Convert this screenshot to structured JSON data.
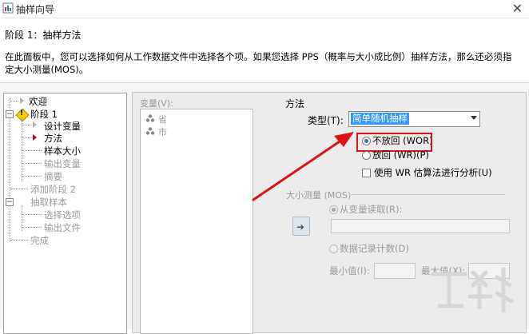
{
  "window": {
    "title": "抽样向导",
    "close_glyph": "✕"
  },
  "stage": {
    "title": "阶段 1：抽样方法",
    "description": "在此面板中，您可以选择如何从工作数据文件中选择各个项。如果您选择 PPS（概率与大小成比例）抽样方法，那么还必须指定大小测量(MOS)。"
  },
  "tree": {
    "welcome": "欢迎",
    "stage1": "阶段 1",
    "design_vars": "设计变量",
    "method": "方法",
    "sample_size": "样本大小",
    "output_vars": "输出变量",
    "summary": "摘要",
    "add_stage2": "添加阶段 2",
    "draw_sample": "抽取样本",
    "select_options": "选择选项",
    "output_files": "输出文件",
    "finish": "完成"
  },
  "variables": {
    "label": "变量(V):",
    "items": [
      "省",
      "市"
    ]
  },
  "method": {
    "section_label": "方法",
    "type_label": "类型(T):",
    "type_value": "简单随机抽样",
    "without_replacement": "不放回 (WOR)",
    "with_replacement": "放回 (WR)(P)",
    "use_wr_estimation": "使用 WR 估算法进行分析(U)"
  },
  "size_measure": {
    "section_label": "大小测量 (MOS)",
    "read_from_variable": "从变量读取(R):",
    "record_count": "数据记录计数(D)",
    "min_label": "最小值(I):",
    "max_label": "最大值(X):"
  },
  "colors": {
    "annotation_red": "#d8151b",
    "selection_blue": "#3399ff",
    "stage_diamond": "#f7cf00"
  },
  "icons": {
    "nav_arrow_active": "red-triangle",
    "nav_arrow_inactive": "gray-triangle",
    "stage_icon": "yellow-diamond",
    "move_button": "right-arrow",
    "variable_icon": "nominal-variable"
  }
}
